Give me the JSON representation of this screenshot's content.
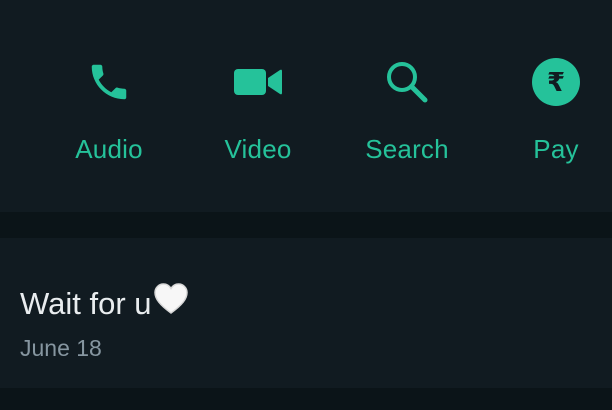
{
  "actions": [
    {
      "label": "Audio",
      "icon": "phone-icon"
    },
    {
      "label": "Video",
      "icon": "video-camera-icon"
    },
    {
      "label": "Search",
      "icon": "search-icon"
    },
    {
      "label": "Pay",
      "icon": "rupee-icon",
      "symbol": "₹"
    }
  ],
  "about": {
    "text": "Wait for u",
    "emoji_icon": "white-heart-icon",
    "date": "June 18"
  },
  "colors": {
    "background": "#111b21",
    "divider": "#0b1418",
    "accent": "#25c29a",
    "primary_text": "#e9edef",
    "secondary_text": "#8696a0"
  }
}
